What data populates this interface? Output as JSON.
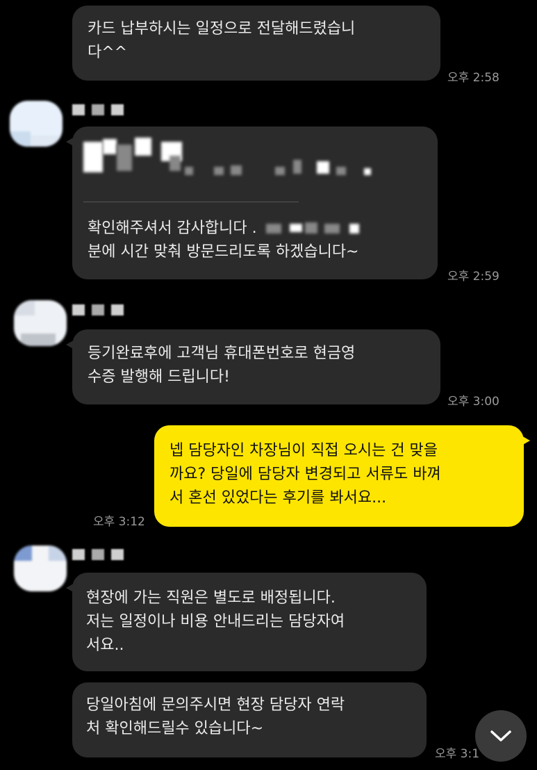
{
  "messages": [
    {
      "lines": [
        "카드 납부하시는 일정으로 전달해드렸습니",
        "다^^"
      ],
      "time": "오후 2:58"
    },
    {
      "lines": [
        "확인해주셔서 감사합니다 . ",
        "분에 시간 맞춰 방문드리도록 하겠습니다~"
      ],
      "time": "오후 2:59"
    },
    {
      "lines": [
        "등기완료후에 고객님 휴대폰번호로 현금영",
        "수증 발행해 드립니다!"
      ],
      "time": "오후 3:00"
    },
    {
      "lines": [
        "넵 담당자인 차장님이 직접 오시는 건 맞을",
        "까요? 당일에 담당자 변경되고 서류도 바껴",
        "서 혼선 있었다는 후기를 봐서요..."
      ],
      "time": "오후 3:12"
    },
    {
      "lines": [
        "현장에 가는 직원은 별도로 배정됩니다.",
        "저는 일정이나 비용 안내드리는 담당자여",
        "서요.."
      ]
    },
    {
      "lines": [
        "당일아침에 문의주시면 현장 담당자 연락",
        "처 확인해드릴수 있습니다~"
      ],
      "time": "오후 3:1"
    }
  ],
  "colors": {
    "background": "#000000",
    "received_bubble": "#2b2b2b",
    "sent_bubble": "#fee500",
    "time_text": "#9a9a9a"
  },
  "icons": {
    "scroll_down": "chevron-down-icon"
  }
}
